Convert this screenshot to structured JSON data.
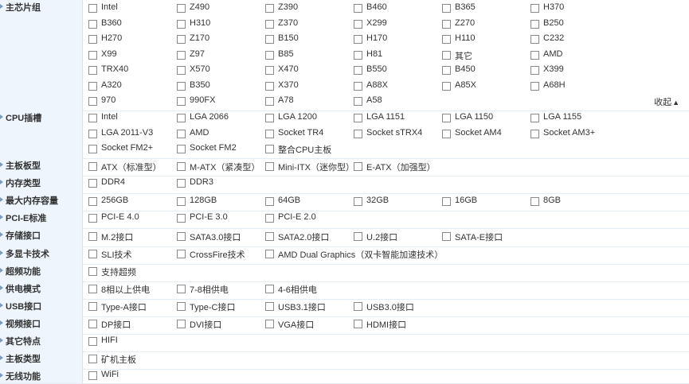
{
  "filters": [
    {
      "label": "主芯片组",
      "collapse_label": "收起",
      "collapse_icon": "▲",
      "options": [
        "Intel",
        "Z490",
        "Z390",
        "B460",
        "B365",
        "H370",
        "B360",
        "H310",
        "Z370",
        "X299",
        "Z270",
        "B250",
        "H270",
        "Z170",
        "B150",
        "H170",
        "H110",
        "C232",
        "X99",
        "Z97",
        "B85",
        "H81",
        "其它",
        "AMD",
        "TRX40",
        "X570",
        "X470",
        "B550",
        "B450",
        "X399",
        "A320",
        "B350",
        "X370",
        "A88X",
        "A85X",
        "A68H",
        "970",
        "990FX",
        "A78",
        "A58"
      ]
    },
    {
      "label": "CPU插槽",
      "options": [
        "Intel",
        "LGA 2066",
        "LGA 1200",
        "LGA 1151",
        "LGA 1150",
        "LGA 1155",
        "LGA 2011-V3",
        "AMD",
        "Socket TR4",
        "Socket sTRX4",
        "Socket AM4",
        "Socket AM3+",
        "Socket FM2+",
        "Socket FM2",
        "整合CPU主板"
      ]
    },
    {
      "label": "主板板型",
      "options": [
        "ATX（标准型）",
        "M-ATX（紧凑型）",
        "Mini-ITX（迷你型）",
        "E-ATX（加强型）"
      ]
    },
    {
      "label": "内存类型",
      "options": [
        "DDR4",
        "DDR3"
      ]
    },
    {
      "label": "最大内存容量",
      "options": [
        "256GB",
        "128GB",
        "64GB",
        "32GB",
        "16GB",
        "8GB"
      ]
    },
    {
      "label": "PCI-E标准",
      "options": [
        "PCI-E 4.0",
        "PCI-E 3.0",
        "PCI-E 2.0"
      ]
    },
    {
      "label": "存储接口",
      "options": [
        "M.2接口",
        "SATA3.0接口",
        "SATA2.0接口",
        "U.2接口",
        "SATA-E接口"
      ]
    },
    {
      "label": "多显卡技术",
      "options": [
        "SLI技术",
        "CrossFire技术",
        "AMD Dual Graphics（双卡智能加速技术）"
      ]
    },
    {
      "label": "超频功能",
      "options": [
        "支持超频"
      ]
    },
    {
      "label": "供电模式",
      "options": [
        "8相以上供电",
        "7-8相供电",
        "4-6相供电"
      ]
    },
    {
      "label": "USB接口",
      "options": [
        "Type-A接口",
        "Type-C接口",
        "USB3.1接口",
        "USB3.0接口"
      ]
    },
    {
      "label": "视频接口",
      "options": [
        "DP接口",
        "DVI接口",
        "VGA接口",
        "HDMI接口"
      ]
    },
    {
      "label": "其它特点",
      "options": [
        "HIFI"
      ]
    },
    {
      "label": "主板类型",
      "options": [
        "矿机主板"
      ]
    },
    {
      "label": "无线功能",
      "options": [
        "WiFi"
      ]
    }
  ]
}
